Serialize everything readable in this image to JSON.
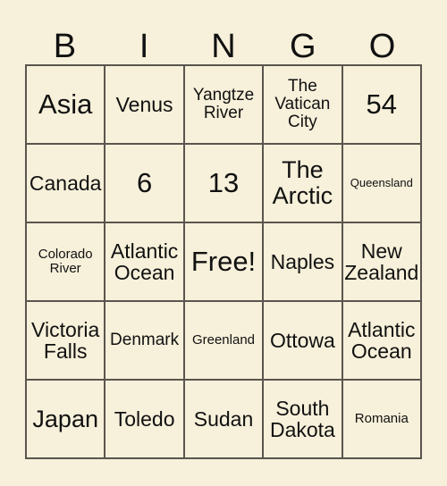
{
  "card": {
    "header_letters": [
      "B",
      "I",
      "N",
      "G",
      "O"
    ],
    "background_color": "#f7f0da",
    "border_color": "#5a554e",
    "text_color": "#111111",
    "rows": 5,
    "columns": 5,
    "free_space": "Free!",
    "cells": [
      [
        {
          "text": "Asia",
          "size": "fs-xl"
        },
        {
          "text": "Venus",
          "size": "fs-md"
        },
        {
          "text": "Yangtze\nRiver",
          "size": "fs-sm"
        },
        {
          "text": "The\nVatican\nCity",
          "size": "fs-sm"
        },
        {
          "text": "54",
          "size": "fs-xl"
        }
      ],
      [
        {
          "text": "Canada",
          "size": "fs-md"
        },
        {
          "text": "6",
          "size": "fs-xl"
        },
        {
          "text": "13",
          "size": "fs-xl"
        },
        {
          "text": "The\nArctic",
          "size": "fs-lg"
        },
        {
          "text": "Queensland",
          "size": "fs-xxs"
        }
      ],
      [
        {
          "text": "Colorado\nRiver",
          "size": "fs-xs"
        },
        {
          "text": "Atlantic\nOcean",
          "size": "fs-md"
        },
        {
          "text": "Free!",
          "size": "fs-xl"
        },
        {
          "text": "Naples",
          "size": "fs-md"
        },
        {
          "text": "New\nZealand",
          "size": "fs-md"
        }
      ],
      [
        {
          "text": "Victoria\nFalls",
          "size": "fs-md"
        },
        {
          "text": "Denmark",
          "size": "fs-sm"
        },
        {
          "text": "Greenland",
          "size": "fs-xs"
        },
        {
          "text": "Ottowa",
          "size": "fs-md"
        },
        {
          "text": "Atlantic\nOcean",
          "size": "fs-md"
        }
      ],
      [
        {
          "text": "Japan",
          "size": "fs-lg"
        },
        {
          "text": "Toledo",
          "size": "fs-md"
        },
        {
          "text": "Sudan",
          "size": "fs-md"
        },
        {
          "text": "South\nDakota",
          "size": "fs-md"
        },
        {
          "text": "Romania",
          "size": "fs-xs"
        }
      ]
    ]
  }
}
